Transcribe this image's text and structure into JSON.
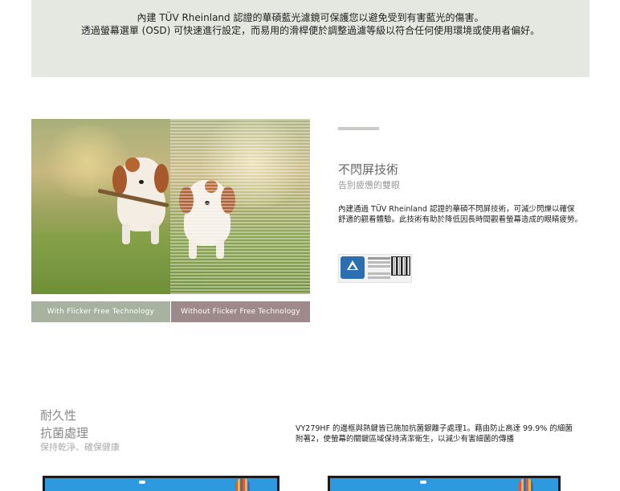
{
  "banner": {
    "line1": "內建 TÜV Rheinland 認證的華碩藍光濾鏡可保護您以避免受到有害藍光的傷害。",
    "line2": "透過螢幕選單 (OSD) 可快速進行設定，而易用的滑桿便於調整過濾等級以符合任何使用環境或使用者偏好。"
  },
  "flicker": {
    "caption_left": "With Flicker Free Technology",
    "caption_right": "Without Flicker Free Technology",
    "title": "不閃屏技術",
    "subtitle": "告別疲憊的雙眼",
    "body_lines": [
      "內建通過 TÜV Rheinland 認證的華碩不閃屏技術，可減少閃爍以確保",
      "舒適的觀看體驗。此技術有助於降低因長時間觀看螢幕造成的眼睛疲勞。"
    ],
    "cert": {
      "brand_icon": "tuv-rheinland-logo-icon",
      "qr_icon": "qr-code-icon"
    }
  },
  "durability": {
    "title1": "耐久性",
    "title2": "抗菌處理",
    "subtitle": "保持乾淨、確保健康",
    "body_lines": [
      "VY279HF 的邊框與熱鍵皆已施加抗菌銀離子處理1。藉由防止高達 99.9% 的細菌",
      "附著2，使螢幕的關鍵區域保持清潔衛生，以減少有害細菌的傳播"
    ]
  },
  "colors": {
    "banner_bg": "#e5e7e1",
    "caption_left_bg": "#a7b3a0",
    "caption_right_bg": "#9e8a8a",
    "accent": "#c9cbc4"
  }
}
